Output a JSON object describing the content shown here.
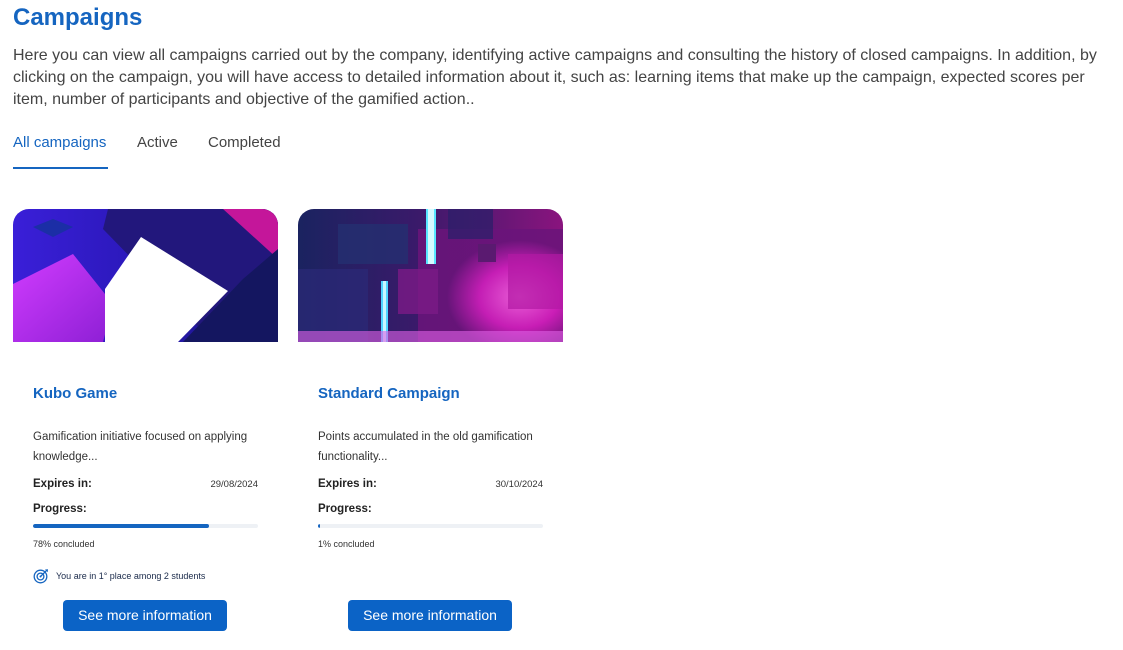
{
  "page": {
    "title": "Campaigns",
    "intro": "Here you can view all campaigns carried out by the company, identifying active campaigns and consulting the history of closed campaigns. In addition, by clicking on the campaign, you will have access to detailed information about it, such as: learning items that make up the campaign, expected scores per item, number of participants and objective of the gamified action.."
  },
  "tabs": [
    {
      "label": "All campaigns",
      "selected": true
    },
    {
      "label": "Active",
      "selected": false
    },
    {
      "label": "Completed",
      "selected": false
    }
  ],
  "colors": {
    "accent": "#1565c0",
    "button": "#0b63c6",
    "track": "#eef1f5"
  },
  "campaigns": [
    {
      "title": "Kubo Game",
      "description": "Gamification initiative focused on applying knowledge...",
      "expires_label": "Expires in:",
      "expires_value": "29/08/2024",
      "progress_label": "Progress:",
      "progress_fraction": 0.78,
      "progress_text": "78% concluded",
      "rank_icon": "target-icon",
      "rank_text": "You are in 1° place among 2 students",
      "button_label": "See more information"
    },
    {
      "title": "Standard Campaign",
      "description": "Points accumulated in the old gamification functionality...",
      "expires_label": "Expires in:",
      "expires_value": "30/10/2024",
      "progress_label": "Progress:",
      "progress_fraction": 0.01,
      "progress_text": "1% concluded",
      "button_label": "See more information"
    }
  ]
}
